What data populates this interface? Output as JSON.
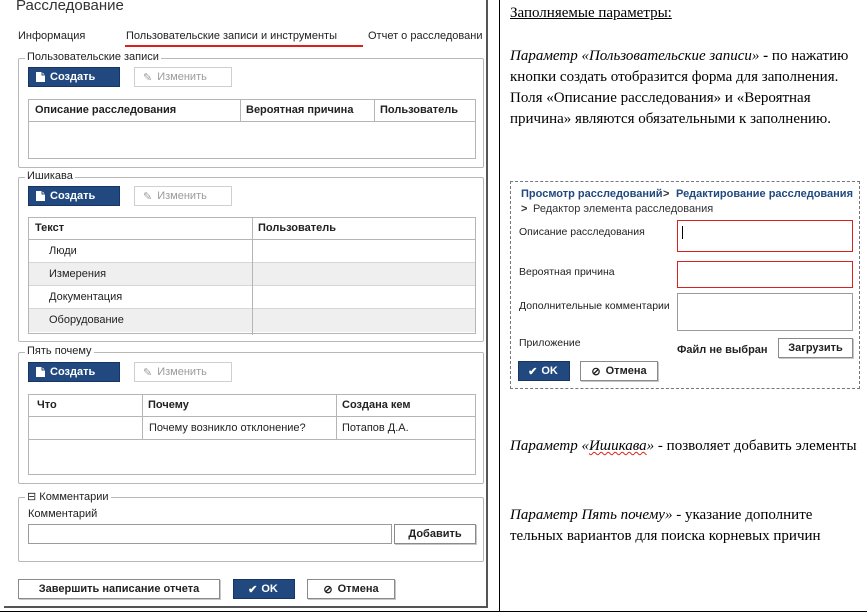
{
  "app": {
    "title": "Расследование",
    "tabs": [
      {
        "label": "Информация",
        "active": false
      },
      {
        "label": "Пользовательские записи и инструменты",
        "active": true
      },
      {
        "label": "Отчет о расследовани",
        "active": false
      }
    ],
    "sections": {
      "user_records": {
        "legend": "Пользовательские записи",
        "create_label": "Создать",
        "edit_label": "Изменить",
        "columns": [
          "Описание расследования",
          "Вероятная причина",
          "Пользователь"
        ]
      },
      "ishikawa": {
        "legend": "Ишикава",
        "create_label": "Создать",
        "edit_label": "Изменить",
        "columns": [
          "Текст",
          "Пользователь"
        ],
        "rows": [
          "Люди",
          "Измерения",
          "Документация",
          "Оборудование"
        ]
      },
      "five_whys": {
        "legend": "Пять почему",
        "create_label": "Создать",
        "edit_label": "Изменить",
        "columns": [
          "Что",
          "Почему",
          "Создана кем"
        ],
        "rows": [
          {
            "what": "",
            "why": "Почему возникло отклонение?",
            "created_by": "Потапов Д.А."
          }
        ]
      },
      "comments": {
        "legend": "Комментарии",
        "toggle": "⊟",
        "field_label": "Комментарий",
        "field_value": "",
        "add_label": "Добавить"
      }
    },
    "footer": {
      "finish_label": "Завершить написание отчета",
      "ok_label": "OK",
      "cancel_label": "Отмена"
    }
  },
  "doc": {
    "heading": "Заполняемые параметры:",
    "p1_term": "Параметр «Пользовательские записи»",
    "p1_dash": " - ",
    "p1_text": "по нажатию кнопки создать отобразится форма для заполнения.",
    "p1_text2": "Поля «Описание расследования» и «Вероятная причина» являются обязательными к заполнению.",
    "p2_term_a": "Параметр «",
    "p2_term_b": "Ишикава",
    "p2_term_c": "»",
    "p2_text": " - позволяет добавить элементы",
    "p3_term": "Параметр Пять почему»",
    "p3_text": " - указание дополните тельных вариантов для поиска корневых причин"
  },
  "inset": {
    "breadcrumb": [
      "Просмотр расследований",
      "Редактирование расследования",
      "Редактор элемента расследования"
    ],
    "separator": ">",
    "fields": [
      {
        "label": "Описание расследования",
        "value": "",
        "required": true
      },
      {
        "label": "Вероятная причина",
        "value": "",
        "required": true
      },
      {
        "label": "Дополнительные комментарии",
        "value": "",
        "required": false
      }
    ],
    "attachment_label": "Приложение",
    "no_file_text": "Файл не выбран",
    "upload_label": "Загрузить",
    "ok_label": "OK",
    "cancel_label": "Отмена"
  },
  "colors": {
    "primary": "#21497f",
    "accent_red": "#d9221c"
  }
}
